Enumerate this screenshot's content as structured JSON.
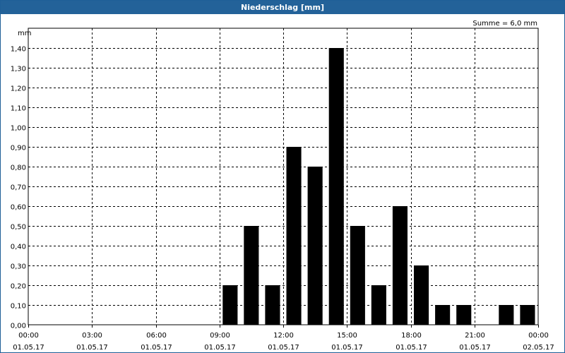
{
  "window": {
    "title": "Niederschlag [mm]"
  },
  "chart_data": {
    "type": "bar",
    "title": "Niederschlag [mm]",
    "ylabel": "mm",
    "xlabel": "",
    "annotation": "Summe = 6,0 mm",
    "ylim": [
      0,
      1.5
    ],
    "xlim_hours": [
      0,
      24
    ],
    "y_ticks": [
      "0,00",
      "0,10",
      "0,20",
      "0,30",
      "0,40",
      "0,50",
      "0,60",
      "0,70",
      "0,80",
      "0,90",
      "1,00",
      "1,10",
      "1,20",
      "1,30",
      "1,40"
    ],
    "x_ticks": [
      {
        "time": "00:00",
        "date": "01.05.17"
      },
      {
        "time": "03:00",
        "date": "01.05.17"
      },
      {
        "time": "06:00",
        "date": "01.05.17"
      },
      {
        "time": "09:00",
        "date": "01.05.17"
      },
      {
        "time": "12:00",
        "date": "01.05.17"
      },
      {
        "time": "15:00",
        "date": "01.05.17"
      },
      {
        "time": "18:00",
        "date": "01.05.17"
      },
      {
        "time": "21:00",
        "date": "01.05.17"
      },
      {
        "time": "00:00",
        "date": "02.05.17"
      }
    ],
    "categories": [
      "00:00",
      "01:00",
      "02:00",
      "03:00",
      "04:00",
      "05:00",
      "06:00",
      "07:00",
      "08:00",
      "09:00",
      "10:00",
      "11:00",
      "12:00",
      "13:00",
      "14:00",
      "15:00",
      "16:00",
      "17:00",
      "18:00",
      "19:00",
      "20:00",
      "21:00",
      "22:00",
      "23:00"
    ],
    "values": [
      0,
      0,
      0,
      0,
      0,
      0,
      0,
      0,
      0,
      0.2,
      0.5,
      0.2,
      0.9,
      0.8,
      1.4,
      0.5,
      0.2,
      0.6,
      0.3,
      0.1,
      0.1,
      0,
      0.1,
      0.1
    ],
    "bar_color": "#000000",
    "grid": true
  }
}
